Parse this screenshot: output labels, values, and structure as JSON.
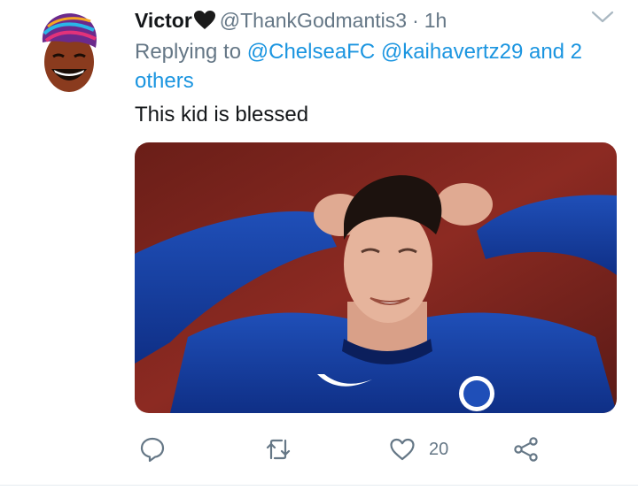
{
  "tweet": {
    "author_name": "Victor",
    "author_emoji": "black-heart",
    "handle": "@ThankGodmantis3",
    "separator": "·",
    "time": "1h",
    "reply_prefix": "Replying to",
    "reply_to": [
      "@ChelseaFC",
      "@kaihavertz29"
    ],
    "reply_others": "and 2 others",
    "text": "This kid is blessed",
    "media_alt": "Footballer in blue Chelsea kit holding his head with both hands"
  },
  "actions": {
    "reply_icon": "comment-icon",
    "retweet_icon": "retweet-icon",
    "like_icon": "heart-icon",
    "like_count": "20",
    "share_icon": "share-icon"
  },
  "colors": {
    "link": "#1b95e0",
    "muted": "#657786",
    "text": "#14171a"
  }
}
